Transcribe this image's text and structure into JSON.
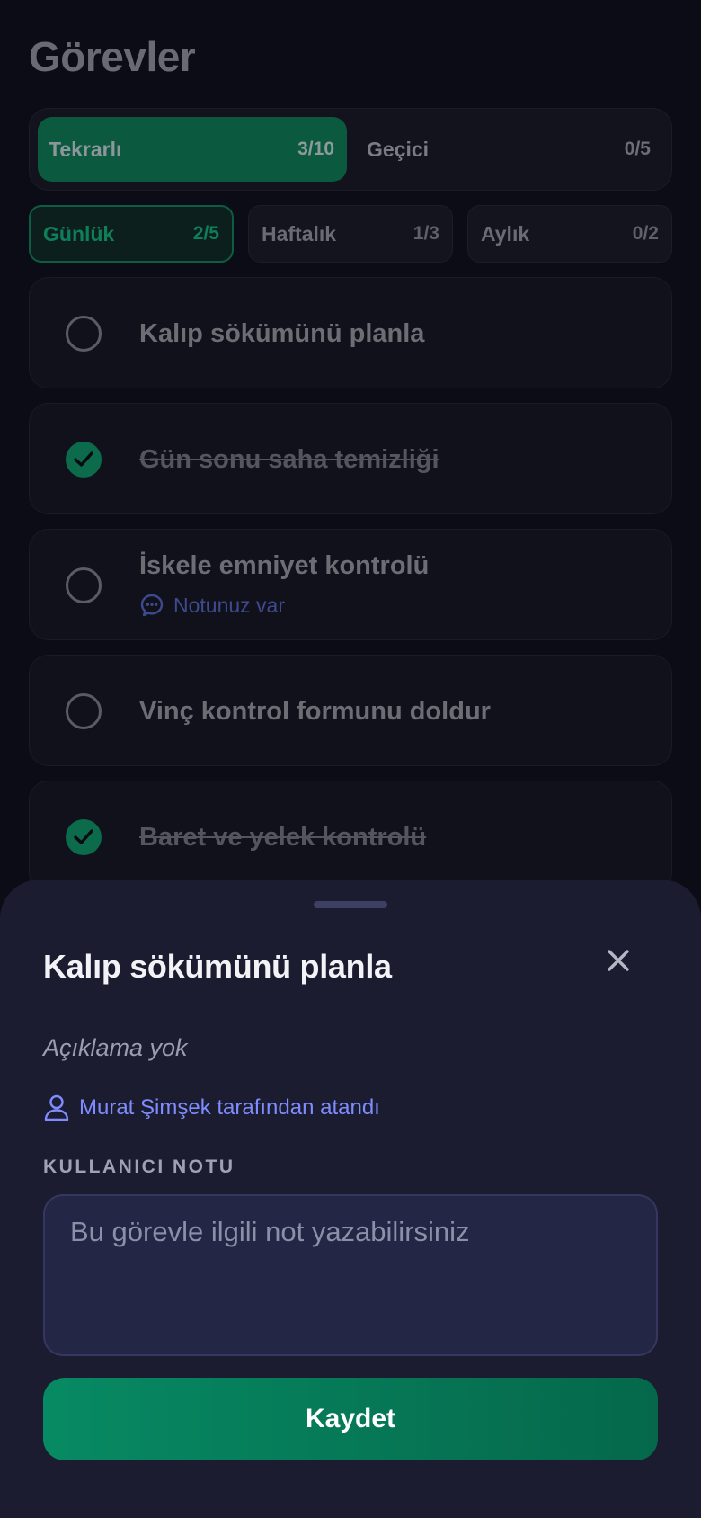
{
  "page": {
    "title": "Görevler"
  },
  "segments": [
    {
      "label": "Tekrarlı",
      "count": "3/10",
      "active": true
    },
    {
      "label": "Geçici",
      "count": "0/5",
      "active": false
    }
  ],
  "periods": [
    {
      "label": "Günlük",
      "count": "2/5",
      "active": true
    },
    {
      "label": "Haftalık",
      "count": "1/3",
      "active": false
    },
    {
      "label": "Aylık",
      "count": "0/2",
      "active": false
    }
  ],
  "tasks": [
    {
      "title": "Kalıp sökümünü planla",
      "done": false
    },
    {
      "title": "Gün sonu saha temizliği",
      "done": true
    },
    {
      "title": "İskele emniyet kontrolü",
      "done": false,
      "note": "Notunuz var"
    },
    {
      "title": "Vinç kontrol formunu doldur",
      "done": false
    },
    {
      "title": "Baret ve yelek kontrolü",
      "done": true
    }
  ],
  "sheet": {
    "title": "Kalıp sökümünü planla",
    "description": "Açıklama yok",
    "assigned_by": "Murat Şimşek tarafından atandı",
    "note_label": "KULLANICI NOTU",
    "note_placeholder": "Bu görevle ilgili not yazabilirsiniz",
    "note_value": "",
    "save_label": "Kaydet"
  },
  "colors": {
    "accent_green": "#078a63",
    "link_blue": "#7f8cff",
    "sheet_bg": "#1b1c2f",
    "page_bg": "#0b0c16"
  }
}
